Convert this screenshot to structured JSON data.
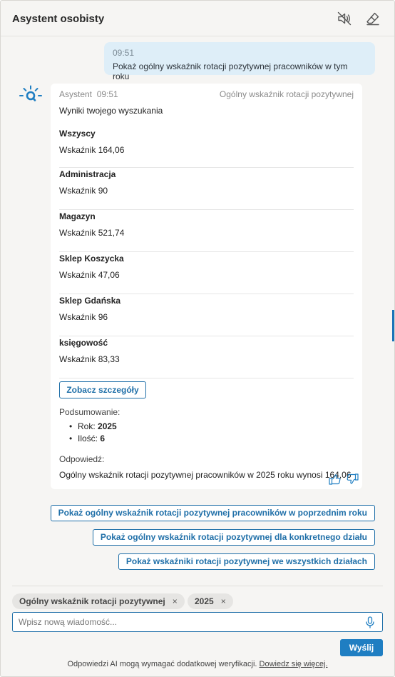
{
  "header": {
    "title": "Asystent osobisty",
    "mute_icon": "speaker-muted-icon",
    "clear_icon": "eraser-icon"
  },
  "user_message": {
    "time": "09:51",
    "text": "Pokaż ogólny wskaźnik rotacji pozytywnej pracowników w tym roku"
  },
  "bot_message": {
    "avatar_icon": "assistant-logo-icon",
    "sender": "Asystent",
    "time": "09:51",
    "topic": "Ogólny wskaźnik rotacji pozytywnej",
    "intro": "Wyniki twojego wyszukania",
    "results": [
      {
        "name": "Wszyscy",
        "label": "Wskaźnik",
        "value": "164,06"
      },
      {
        "name": "Administracja",
        "label": "Wskaźnik",
        "value": "90"
      },
      {
        "name": "Magazyn",
        "label": "Wskaźnik",
        "value": "521,74"
      },
      {
        "name": "Sklep Koszycka",
        "label": "Wskaźnik",
        "value": "47,06"
      },
      {
        "name": "Sklep Gdańska",
        "label": "Wskaźnik",
        "value": "96"
      },
      {
        "name": "księgowość",
        "label": "Wskaźnik",
        "value": "83,33"
      }
    ],
    "details_button": "Zobacz szczegóły",
    "summary_label": "Podsumowanie:",
    "summary": [
      {
        "label": "Rok:",
        "value": "2025"
      },
      {
        "label": "Ilość:",
        "value": "6"
      }
    ],
    "answer_label": "Odpowiedź:",
    "answer_text": "Ogólny wskaźnik rotacji pozytywnej pracowników w 2025 roku wynosi 164,06",
    "feedback_icons": [
      "thumbs-up-icon",
      "thumbs-down-icon"
    ]
  },
  "suggestions": [
    "Pokaż ogólny wskaźnik rotacji pozytywnej pracowników w poprzednim roku",
    "Pokaż ogólny wskaźnik rotacji pozytywnej dla konkretnego działu",
    "Pokaż wskaźniki rotacji pozytywnej we wszystkich działach"
  ],
  "filters": [
    {
      "label": "Ogólny wskaźnik rotacji pozytywnej",
      "remove": "×"
    },
    {
      "label": "2025",
      "remove": "×"
    }
  ],
  "composer": {
    "placeholder": "Wpisz nową wiadomość...",
    "mic_icon": "microphone-icon",
    "send_label": "Wyślij"
  },
  "disclaimer": {
    "text": "Odpowiedzi AI mogą wymagać dodatkowej weryfikacji.",
    "link": "Dowiedz się więcej."
  },
  "colors": {
    "accent": "#1f6fa8",
    "send_button": "#1f7ec2",
    "user_bubble": "#deeef8",
    "panel_bg": "#f6f5f3",
    "chip_bg": "#e6e5e3"
  }
}
